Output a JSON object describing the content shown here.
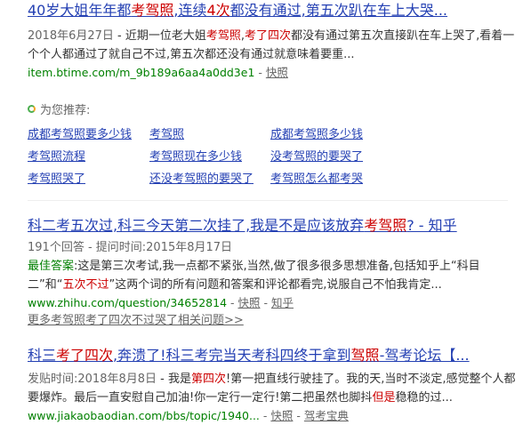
{
  "result1": {
    "title_a": "40岁大姐年年都",
    "title_b": "考驾照",
    "title_c": ",连续",
    "title_d": "4次",
    "title_e": "都没有通过,第五次趴在车上大哭...",
    "date": "2018年6月27日",
    "abs_a": " - 近期一位老大姐",
    "abs_b": "考驾照",
    "abs_c": ",",
    "abs_d": "考了",
    "abs_e": "四次",
    "abs_f": "都没有通过第五次直接趴在车上哭了,看着一个个人都通过了就自己不过,第五次都还没有通过就意味着要重...",
    "url": "item.btime.com/m_9b189a6aa4a0dd3e1",
    "sep": " - ",
    "snapshot": "快照"
  },
  "recommend": {
    "heading": "为您推荐:",
    "items": [
      "成都考驾照要多少钱",
      "考驾照",
      "成都考驾照多少钱",
      "考驾照流程",
      "考驾照现在多少钱",
      "没考驾照的要哭了",
      "考驾照哭了",
      "还没考驾照的要哭了",
      "考驾照怎么都考哭"
    ]
  },
  "result2": {
    "title_a": "科二考五次过,科三今天第二次挂了,我是不是应该放弃",
    "title_b": "考驾照",
    "title_c": "? - 知乎",
    "meta": "191个回答 - 提问时间:2015年8月17日",
    "best_label": "最佳答案",
    "abs_a": ":这是第三次考试,我一点都不紧张,当然,做了很多很多思想准备,包括知乎上“科目二”和“",
    "abs_b": "五次不过",
    "abs_c": "”这两个词的所有问题和答案和评论都看完,说服自己不怕我肯定...",
    "url": "www.zhihu.com/question/34652814",
    "sep": " - ",
    "snapshot": "快照",
    "sep2": " - ",
    "source": "知乎",
    "more": "更多考驾照考了四次不过哭了相关问题>>"
  },
  "result3": {
    "title_a": "科三",
    "title_b": "考了四次",
    "title_c": ",奔溃了!科三考完当天考科四终于拿到",
    "title_d": "驾照",
    "title_e": "-驾考论坛【...",
    "date": "发贴时间:2018年8月8日",
    "abs_a": " - 我是",
    "abs_b": "第四次",
    "abs_c": "!第一把直线行驶挂了。我的天,当时不淡定,感觉整个人都要爆炸。最后一直安慰自己加油!你一定行一定行!第二把虽然也脚抖",
    "abs_d": "但是",
    "abs_e": "稳稳的过...",
    "url": "www.jiakaobaodian.com/bbs/topic/1940...",
    "sep": " - ",
    "snapshot": "快照",
    "sep2": " - ",
    "source": "驾考宝典"
  }
}
